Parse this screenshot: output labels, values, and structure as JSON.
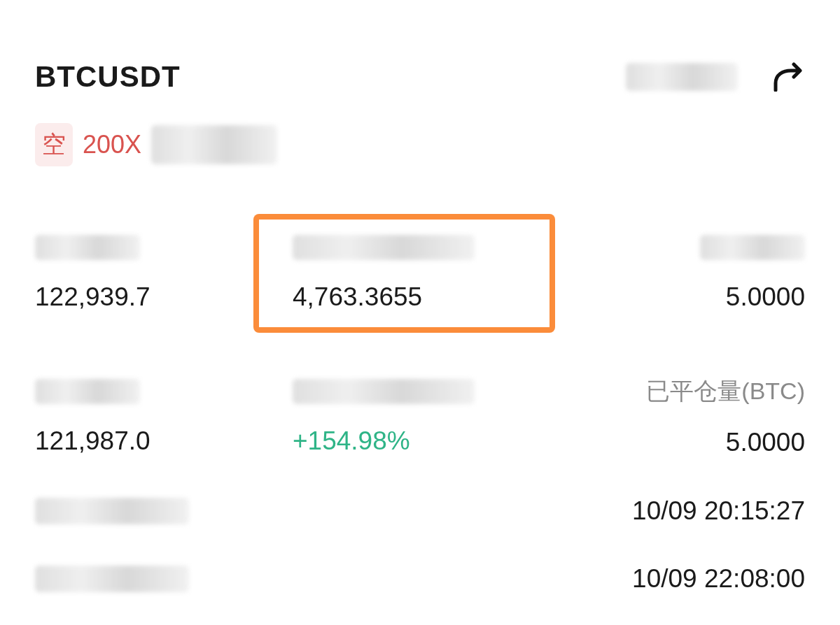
{
  "header": {
    "symbol": "BTCUSDT"
  },
  "tags": [
    {
      "kind": "side",
      "label": "空"
    },
    {
      "kind": "leverage",
      "label": "200X"
    },
    {
      "kind": "mode"
    }
  ],
  "stats": [
    {
      "value": "122,939.7",
      "highlighted": false
    },
    {
      "value": "4,763.3655",
      "highlighted": true
    },
    {
      "value": "5.0000",
      "highlighted": false
    },
    {
      "value": "121,987.0",
      "highlighted": false
    },
    {
      "value": "+154.98%",
      "color": "#2fb487",
      "highlighted": false
    },
    {
      "label": "已平仓量(BTC)",
      "value": "5.0000",
      "highlighted": false
    }
  ],
  "times": [
    {
      "value": "10/09 20:15:27"
    },
    {
      "value": "10/09 22:08:00"
    }
  ]
}
